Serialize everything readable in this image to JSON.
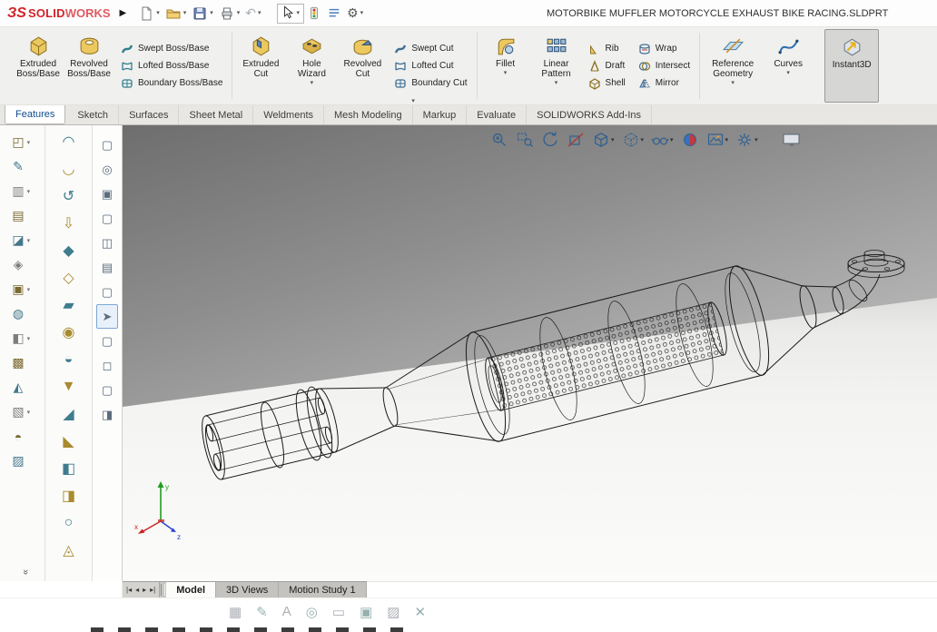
{
  "window": {
    "brand_mark": "ЗS",
    "brand_bold": "SOLID",
    "brand_light": "WORKS",
    "document_title": "MOTORBIKE MUFFLER MOTORCYCLE EXHAUST BIKE RACING.SLDPRT"
  },
  "colors": {
    "brand_red": "#d1232a",
    "feature_gold": "#ecc85f",
    "feature_teal": "#2e7f8f",
    "steel_blue": "#4a7dbd",
    "viewport_wall": "#8a8a8a",
    "viewport_floor": "#f2f2f0"
  },
  "ribbon": {
    "boss": {
      "extruded": "Extruded Boss/Base",
      "revolved": "Revolved Boss/Base",
      "swept": "Swept Boss/Base",
      "lofted": "Lofted Boss/Base",
      "boundary": "Boundary Boss/Base"
    },
    "cut": {
      "extruded": "Extruded Cut",
      "hole_wizard": "Hole Wizard",
      "revolved": "Revolved Cut",
      "swept": "Swept Cut",
      "lofted": "Lofted Cut",
      "boundary": "Boundary Cut"
    },
    "features": {
      "fillet": "Fillet",
      "linear_pattern": "Linear Pattern",
      "rib": "Rib",
      "draft": "Draft",
      "shell": "Shell",
      "wrap": "Wrap",
      "intersect": "Intersect",
      "mirror": "Mirror"
    },
    "reference": {
      "reference_geometry": "Reference Geometry",
      "curves": "Curves"
    },
    "instant3d": "Instant3D"
  },
  "command_tabs": [
    {
      "label": "Features",
      "active": true
    },
    {
      "label": "Sketch"
    },
    {
      "label": "Surfaces"
    },
    {
      "label": "Sheet Metal"
    },
    {
      "label": "Weldments"
    },
    {
      "label": "Mesh Modeling"
    },
    {
      "label": "Markup"
    },
    {
      "label": "Evaluate"
    },
    {
      "label": "SOLIDWORKS Add-Ins"
    }
  ],
  "left_toolbar_primary": [
    {
      "glyph": "◰",
      "dropdown": "▾"
    },
    {
      "glyph": "✎"
    },
    {
      "glyph": "▥",
      "dropdown": "▾"
    },
    {
      "glyph": "▤"
    },
    {
      "glyph": "◪",
      "dropdown": "▾"
    },
    {
      "glyph": "◈"
    },
    {
      "glyph": "▣",
      "dropdown": "▾"
    },
    {
      "glyph": "◍"
    },
    {
      "glyph": "◧",
      "dropdown": "▾"
    },
    {
      "glyph": "▩"
    },
    {
      "glyph": "◭"
    },
    {
      "glyph": "▧",
      "dropdown": "▾"
    },
    {
      "glyph": "◓"
    },
    {
      "glyph": "▨"
    }
  ],
  "left_toolbar_secondary": [
    "◠",
    "◡",
    "↺",
    "⇩",
    "◆",
    "◇",
    "▰",
    "◉",
    "◒",
    "▼",
    "◢",
    "◣",
    "◧",
    "◨",
    "○",
    "◬"
  ],
  "view_toolbar": [
    {
      "glyph": "▢"
    },
    {
      "glyph": "◎"
    },
    {
      "glyph": "▣"
    },
    {
      "glyph": "▢"
    },
    {
      "glyph": "◫"
    },
    {
      "glyph": "▤"
    },
    {
      "glyph": "▢"
    },
    {
      "glyph": "➤",
      "active": true
    },
    {
      "glyph": "▢"
    },
    {
      "glyph": "◻"
    },
    {
      "glyph": "▢"
    },
    {
      "glyph": "◨"
    }
  ],
  "heads_up_icons": [
    "zoom-to-fit",
    "zoom-to-area",
    "previous-view",
    "section-view",
    "view-orientation",
    "display-style",
    "hide-show-items",
    "edit-appearance",
    "apply-scene",
    "view-settings",
    "full-screen"
  ],
  "sheet_nav": [
    "|◂",
    "◂",
    "▸",
    "▸|"
  ],
  "bottom_tabs": [
    {
      "label": "Model",
      "active": true
    },
    {
      "label": "3D Views"
    },
    {
      "label": "Motion Study 1"
    }
  ],
  "triad": {
    "x": "x",
    "y": "y",
    "z": "z"
  },
  "disabled_toolbar": [
    "▦",
    "✎",
    "A",
    "◎",
    "▭",
    "▣",
    "▨",
    "✕"
  ]
}
